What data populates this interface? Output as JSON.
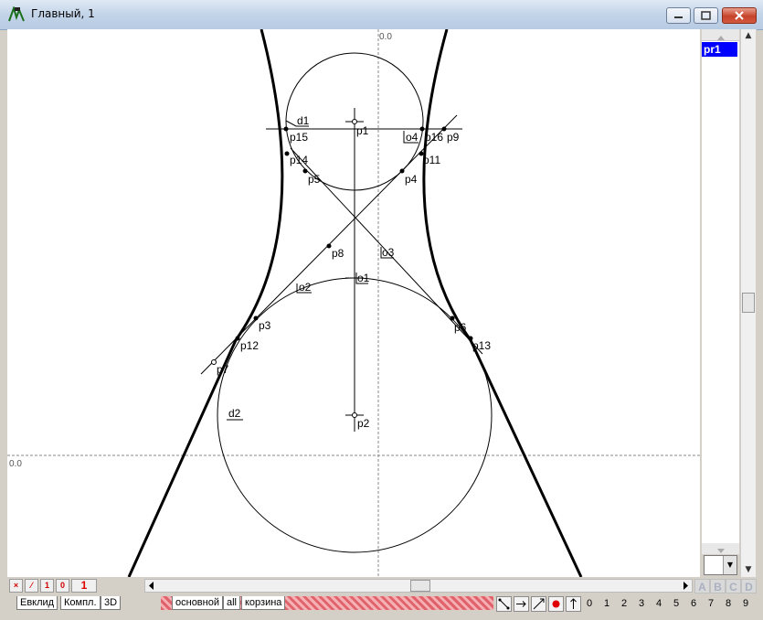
{
  "window": {
    "title": "Главный, 1"
  },
  "canvas": {
    "axis_origin_top": "0.0",
    "axis_origin_left": "0.0",
    "point_labels": [
      "p1",
      "p2",
      "p3",
      "p4",
      "p5",
      "p6",
      "p7",
      "p8",
      "p9",
      "p11",
      "p12",
      "p13",
      "p14",
      "p15",
      "p16"
    ],
    "object_labels": [
      "d1",
      "d2",
      "o1",
      "o2",
      "o3",
      "o4"
    ]
  },
  "layers": {
    "items": [
      "pr1"
    ]
  },
  "toolbar": {
    "counter": "1",
    "mini_buttons": [
      "×",
      "⁄",
      "1",
      "0"
    ]
  },
  "bottom_tabs": [
    "Евклид",
    "Компл.",
    "3D"
  ],
  "layer_tabs": [
    "основной",
    "all",
    "корзина"
  ],
  "letter_buttons": [
    "A",
    "B",
    "C",
    "D"
  ],
  "digit_buttons": [
    "0",
    "1",
    "2",
    "3",
    "4",
    "5",
    "6",
    "7",
    "8",
    "9"
  ],
  "colors": {
    "selected": "#0000ff",
    "accent_red": "#e00000",
    "hatch": "#e0626a"
  },
  "icons": [
    "app-icon",
    "minimize-icon",
    "maximize-icon",
    "close-icon",
    "scroll-up-icon",
    "scroll-down-icon",
    "scroll-left-icon",
    "scroll-right-icon",
    "combo-arrow-icon"
  ]
}
